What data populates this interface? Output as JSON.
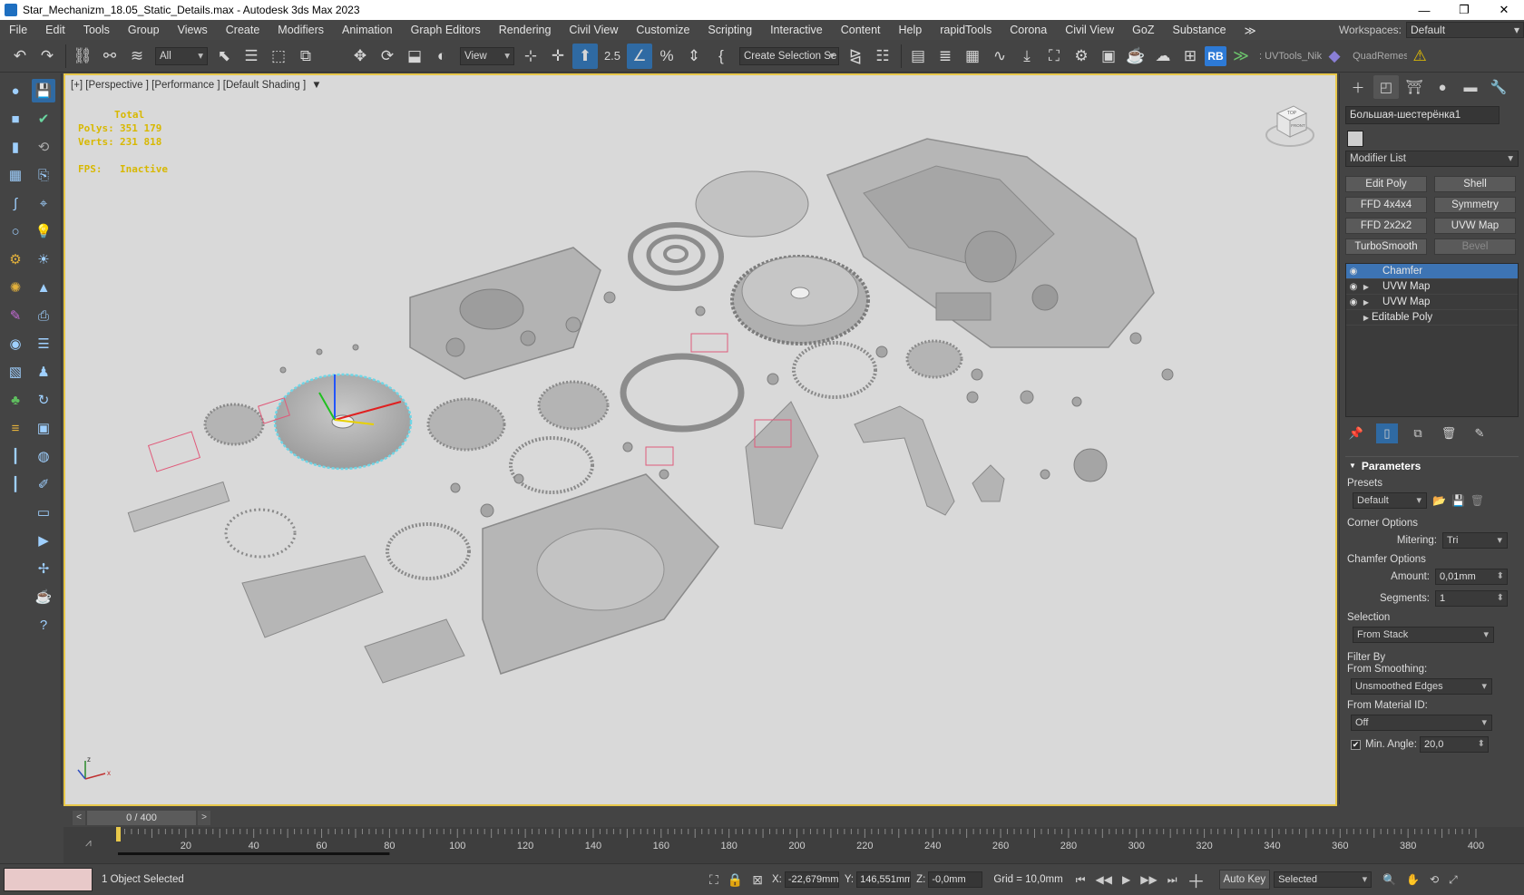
{
  "window": {
    "title": "Star_Mechanizm_18.05_Static_Details.max - Autodesk 3ds Max 2023",
    "minimize": "—",
    "restore": "❐",
    "close": "✕"
  },
  "menu": {
    "items": [
      "File",
      "Edit",
      "Tools",
      "Group",
      "Views",
      "Create",
      "Modifiers",
      "Animation",
      "Graph Editors",
      "Rendering",
      "Civil View",
      "Customize",
      "Scripting",
      "Interactive",
      "Content",
      "Help",
      "rapidTools",
      "Corona",
      "Civil View",
      "GoZ",
      "Substance"
    ],
    "overflow": "≫",
    "workspaces_label": "Workspaces:",
    "workspaces_value": "Default"
  },
  "toolbar": {
    "filter_value": "All",
    "refcoord_value": "View",
    "selection_set_placeholder": "Create Selection Se",
    "uvtools_label": ": UVTools_Nik",
    "quadremesher_label": "QuadRemesher",
    "rb_label": "RB",
    "snap_label": "2.5"
  },
  "viewport": {
    "label": "[+] [Perspective ] [Performance ] [Default Shading ]",
    "stats_total": "Total",
    "polys_label": "Polys:",
    "polys_value": "351 179",
    "verts_label": "Verts:",
    "verts_value": "231 818",
    "fps_label": "FPS:",
    "fps_value": "Inactive",
    "viewcube_top": "TOP",
    "viewcube_front": "FRONT",
    "axis_x": "x",
    "axis_z": "z"
  },
  "command_panel": {
    "object_name": "Большая-шестерёнка1",
    "modifier_list": "Modifier List",
    "modifier_buttons": [
      {
        "label": "Edit Poly",
        "enabled": true
      },
      {
        "label": "Shell",
        "enabled": true
      },
      {
        "label": "FFD 4x4x4",
        "enabled": true
      },
      {
        "label": "Symmetry",
        "enabled": true
      },
      {
        "label": "FFD 2x2x2",
        "enabled": true
      },
      {
        "label": "UVW Map",
        "enabled": true
      },
      {
        "label": "TurboSmooth",
        "enabled": true
      },
      {
        "label": "Bevel",
        "enabled": false
      }
    ],
    "stack": [
      {
        "label": "Chamfer",
        "eye": true,
        "arrow": false,
        "selected": true
      },
      {
        "label": "UVW Map",
        "eye": true,
        "arrow": true,
        "selected": false
      },
      {
        "label": "UVW Map",
        "eye": true,
        "arrow": true,
        "selected": false
      },
      {
        "label": "Editable Poly",
        "eye": false,
        "arrow": true,
        "selected": false
      }
    ],
    "parameters": {
      "title": "Parameters",
      "presets_label": "Presets",
      "presets_value": "Default",
      "corner_options_label": "Corner Options",
      "mitering_label": "Mitering:",
      "mitering_value": "Tri",
      "chamfer_options_label": "Chamfer Options",
      "amount_label": "Amount:",
      "amount_value": "0,01mm",
      "segments_label": "Segments:",
      "segments_value": "1",
      "selection_label": "Selection",
      "selection_value": "From Stack",
      "filter_by_label": "Filter By",
      "from_smoothing_label": "From Smoothing:",
      "from_smoothing_value": "Unsmoothed Edges",
      "from_material_label": "From Material ID:",
      "from_material_value": "Off",
      "min_angle_label": "Min. Angle:",
      "min_angle_value": "20,0",
      "min_angle_checked": true
    }
  },
  "timeline": {
    "frame_display": "0 / 400",
    "prev": "<",
    "next": ">",
    "tick_labels": [
      "20",
      "40",
      "60",
      "80",
      "100",
      "120",
      "140",
      "160",
      "180",
      "200",
      "220",
      "240",
      "260",
      "280",
      "300",
      "320",
      "340",
      "360",
      "380",
      "400"
    ],
    "total_frames": 400
  },
  "status": {
    "selection_message": "1 Object Selected",
    "x_label": "X:",
    "x_value": "-22,679mm",
    "y_label": "Y:",
    "y_value": "146,551mm",
    "z_label": "Z:",
    "z_value": "-0,0mm",
    "grid": "Grid = 10,0mm",
    "auto_key": "Auto Key",
    "key_filter": "Selected"
  }
}
